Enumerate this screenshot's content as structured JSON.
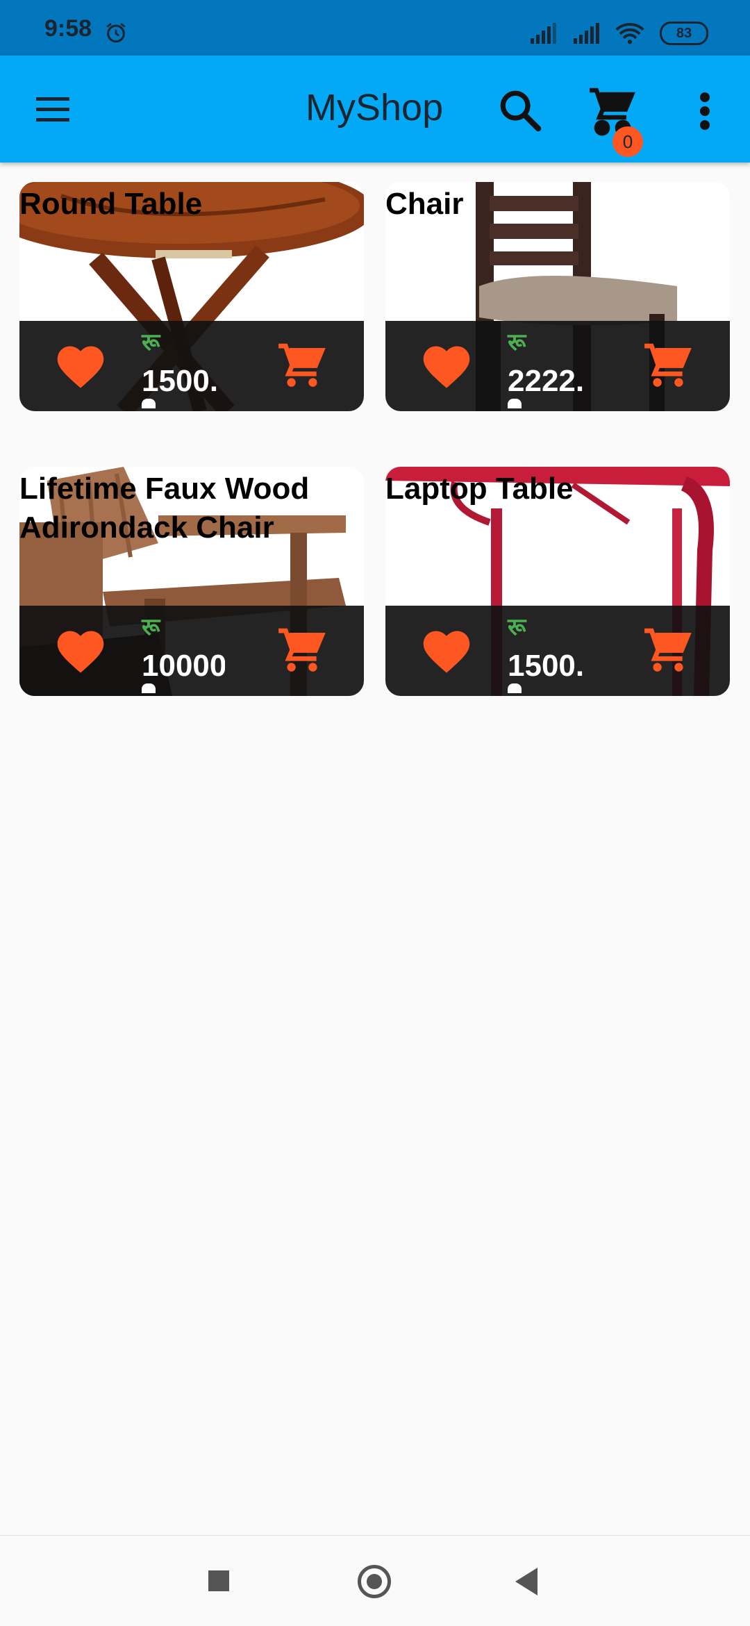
{
  "status_bar": {
    "time": "9:58",
    "battery": "83",
    "icons": [
      "alarm-icon",
      "signal-icon",
      "signal-icon",
      "wifi-icon",
      "battery-icon"
    ]
  },
  "app_bar": {
    "title": "MyShop",
    "cart_count": "0",
    "icons": [
      "menu-icon",
      "search-icon",
      "cart-icon",
      "more-vert-icon"
    ]
  },
  "products": [
    {
      "title": "Round  Table",
      "currency": "रू",
      "price": "1500.",
      "image": "round-table"
    },
    {
      "title": "Chair",
      "currency": "रू",
      "price": "2222.",
      "image": "chair"
    },
    {
      "title": "Lifetime Faux Wood Adirondack Chair",
      "currency": "रू",
      "price": "10000",
      "image": "adirondack-chair"
    },
    {
      "title": "Laptop Table",
      "currency": "रू",
      "price": "1500.",
      "image": "laptop-table"
    }
  ],
  "colors": {
    "status_bar": "#0277bd",
    "app_bar": "#03a9f4",
    "accent": "#ff5722",
    "currency": "#4caf50",
    "card_footer": "#111111"
  },
  "nav_bar": {
    "icons": [
      "recents-square-icon",
      "home-circle-icon",
      "back-triangle-icon"
    ]
  }
}
